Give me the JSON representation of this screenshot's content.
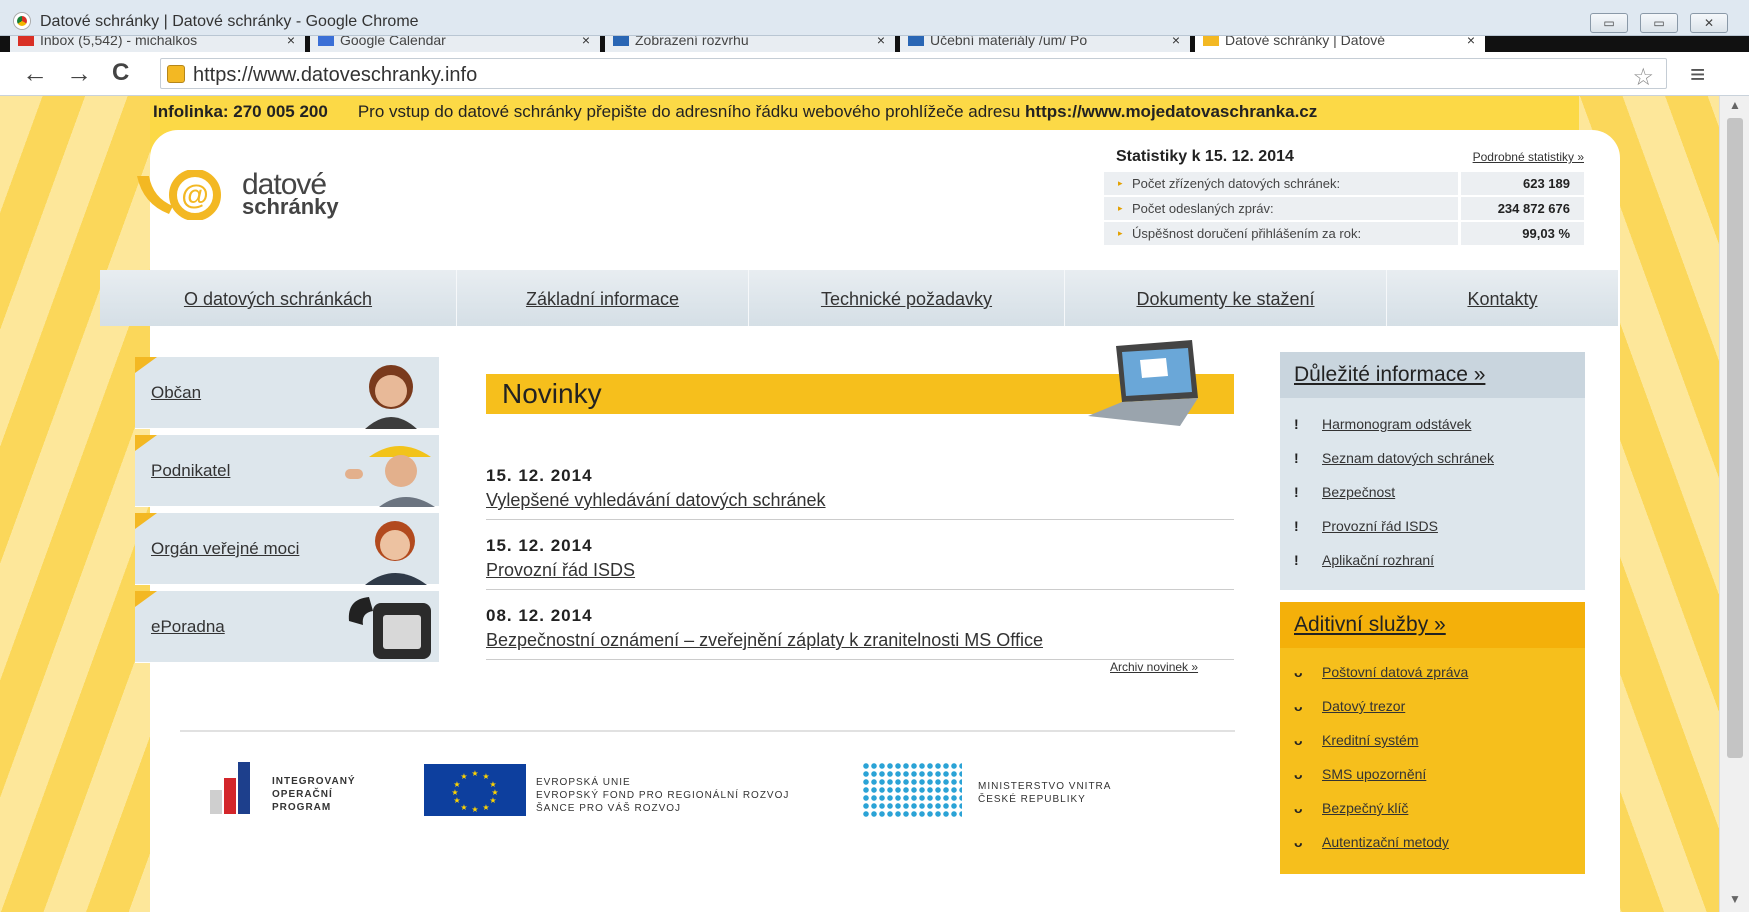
{
  "window": {
    "title": "Datové schránky | Datové schránky - Google Chrome",
    "min": "▭",
    "max": "▭",
    "close": "✕"
  },
  "tabs": [
    {
      "label": "Inbox (5,542) - michalkos",
      "close": "×"
    },
    {
      "label": "Google Calendar",
      "close": "×"
    },
    {
      "label": "Zobrazení rozvrhu",
      "close": "×"
    },
    {
      "label": "Učební materiály /um/ Po",
      "close": "×"
    },
    {
      "label": "Datové schránky | Datové",
      "close": "×"
    }
  ],
  "toolbar": {
    "back": "←",
    "forward": "→",
    "reload": "C",
    "url": "https://www.datoveschranky.info",
    "star": "☆",
    "menu": "≡"
  },
  "infobar": {
    "phone": "Infolinka: 270 005 200",
    "message": "Pro vstup do datové schránky přepište do adresního řádku webového prohlížeče adresu",
    "url": "https://www.mojedatovaschranka.cz"
  },
  "logo": {
    "line1": "datové",
    "line2": "schránky"
  },
  "stats": {
    "heading": "Statistiky k 15. 12. 2014",
    "link": "Podrobné statistiky »",
    "rows": [
      {
        "label": "Počet zřízených datových schránek:",
        "value": "623 189"
      },
      {
        "label": "Počet odeslaných zpráv:",
        "value": "234 872 676"
      },
      {
        "label": "Úspěšnost doručení přihlášením za rok:",
        "value": "99,03 %"
      }
    ]
  },
  "nav": [
    "O datových schránkách",
    "Základní informace",
    "Technické požadavky",
    "Dokumenty ke stažení",
    "Kontakty"
  ],
  "side": [
    "Občan",
    "Podnikatel",
    "Orgán veřejné moci",
    "ePoradna"
  ],
  "news": {
    "title": "Novinky",
    "items": [
      {
        "date": "15. 12. 2014",
        "text": "Vylepšené vyhledávání datových schránek"
      },
      {
        "date": "15. 12. 2014",
        "text": "Provozní řád ISDS"
      },
      {
        "date": "08. 12. 2014",
        "text": "Bezpečnostní oznámení – zveřejnění záplaty k zranitelnosti MS Office"
      }
    ],
    "archive": "Archiv novinek »"
  },
  "important": {
    "title": "Důležité informace »",
    "mark": "!",
    "items": [
      "Harmonogram odstávek",
      "Seznam datových schránek",
      "Bezpečnost",
      "Provozní řád ISDS",
      "Aplikační rozhraní"
    ]
  },
  "services": {
    "title": "Aditivní služby »",
    "items": [
      "Poštovní datová zpráva",
      "Datový trezor",
      "Kreditní systém",
      "SMS upozornění",
      "Bezpečný klíč",
      "Autentizační metody"
    ]
  },
  "footer": {
    "iop": [
      "INTEGROVANÝ",
      "OPERAČNÍ",
      "PROGRAM"
    ],
    "eu": [
      "EVROPSKÁ UNIE",
      "EVROPSKÝ FOND PRO REGIONÁLNÍ ROZVOJ",
      "ŠANCE PRO VÁŠ ROZVOJ"
    ],
    "mv": [
      "MINISTERSTVO VNITRA",
      "ČESKÉ REPUBLIKY"
    ]
  },
  "colors": {
    "accent": "#f6bf1c",
    "background": "#fcd946",
    "nav": "#dde6ec"
  }
}
